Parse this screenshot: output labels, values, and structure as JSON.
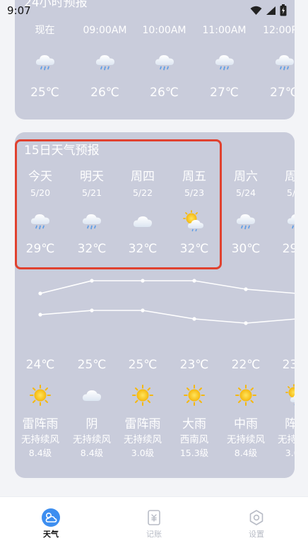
{
  "status_bar": {
    "time": "9:07"
  },
  "hourly": {
    "title": "24小时预报",
    "hours": [
      {
        "label": "现在",
        "icon": "rain-cloud-icon",
        "temp": "25℃"
      },
      {
        "label": "09:00AM",
        "icon": "rain-cloud-icon",
        "temp": "26℃"
      },
      {
        "label": "10:00AM",
        "icon": "rain-cloud-icon",
        "temp": "26℃"
      },
      {
        "label": "11:00AM",
        "icon": "rain-cloud-icon",
        "temp": "27℃"
      },
      {
        "label": "12:00PM",
        "icon": "rain-cloud-icon",
        "temp": "27℃"
      }
    ]
  },
  "daily": {
    "title": "15日天气预报",
    "days": [
      {
        "name": "今天",
        "date": "5/20",
        "day_icon": "rain-cloud-icon",
        "high": "29℃",
        "high_value": 29,
        "low": "24℃",
        "low_value": 24,
        "night_icon": "sun-icon",
        "condition": "雷阵雨",
        "wind_dir": "无持续风",
        "wind_level": "8.4级"
      },
      {
        "name": "明天",
        "date": "5/21",
        "day_icon": "rain-cloud-icon",
        "high": "32℃",
        "high_value": 32,
        "low": "25℃",
        "low_value": 25,
        "night_icon": "cloud-icon",
        "condition": "阴",
        "wind_dir": "无持续风",
        "wind_level": "8.4级"
      },
      {
        "name": "周四",
        "date": "5/22",
        "day_icon": "cloud-icon",
        "high": "32℃",
        "high_value": 32,
        "low": "25℃",
        "low_value": 25,
        "night_icon": "sun-icon",
        "condition": "雷阵雨",
        "wind_dir": "无持续风",
        "wind_level": "3.0级"
      },
      {
        "name": "周五",
        "date": "5/23",
        "day_icon": "sun-cloud-icon",
        "high": "32℃",
        "high_value": 32,
        "low": "23℃",
        "low_value": 23,
        "night_icon": "sun-icon",
        "condition": "大雨",
        "wind_dir": "西南风",
        "wind_level": "15.3级"
      },
      {
        "name": "周六",
        "date": "5/24",
        "day_icon": "rain-cloud-icon",
        "high": "30℃",
        "high_value": 30,
        "low": "22℃",
        "low_value": 22,
        "night_icon": "sun-icon",
        "condition": "中雨",
        "wind_dir": "无持续风",
        "wind_level": "8.4级"
      },
      {
        "name": "周日",
        "date": "5/25",
        "day_icon": "rain-cloud-icon",
        "high": "29℃",
        "high_value": 29,
        "low": "23℃",
        "low_value": 23,
        "night_icon": "sun-cloud-icon",
        "condition": "阵雨",
        "wind_dir": "无持续风",
        "wind_level": "3.0级"
      }
    ]
  },
  "nav": {
    "items": [
      {
        "label": "天气",
        "icon": "weather-icon",
        "active": true
      },
      {
        "label": "记账",
        "icon": "ledger-icon",
        "active": false
      },
      {
        "label": "设置",
        "icon": "settings-icon",
        "active": false
      }
    ]
  },
  "colors": {
    "card": "#c9ccdb",
    "highlight": "#e0412f",
    "nav_active": "#3d8ef0",
    "sun": "#f6c21c"
  }
}
